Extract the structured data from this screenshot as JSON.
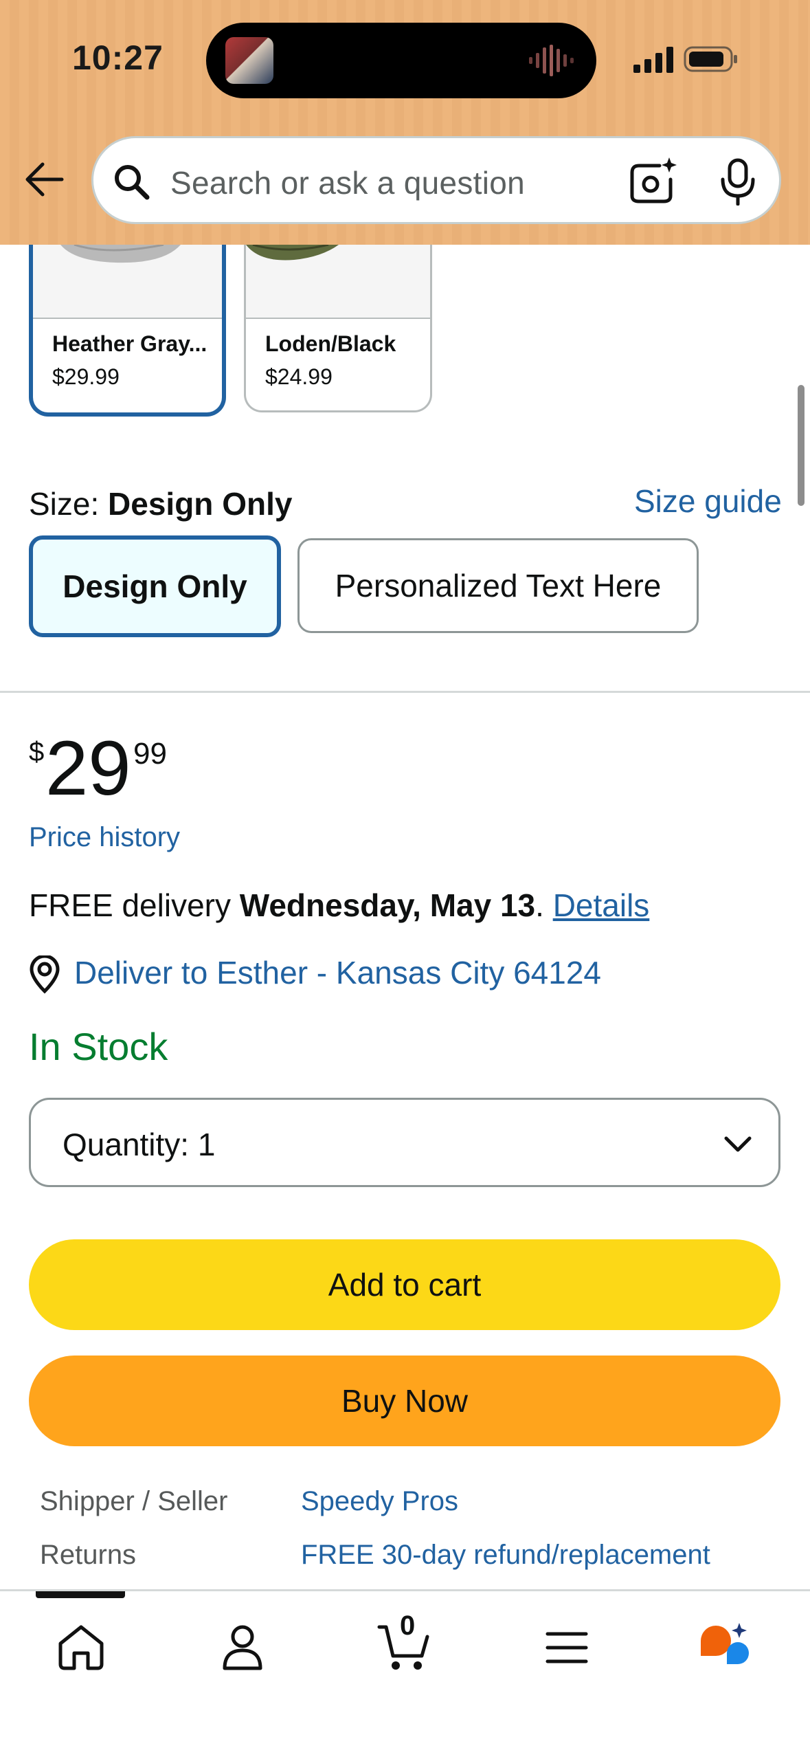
{
  "status_bar": {
    "time": "10:27"
  },
  "search": {
    "placeholder": "Search or ask a question"
  },
  "swatches": [
    {
      "name": "Heather Gray...",
      "price": "$29.99",
      "selected": true
    },
    {
      "name": "Loden/Black",
      "price": "$24.99",
      "selected": false
    }
  ],
  "size": {
    "label": "Size:",
    "selected_value": "Design Only",
    "guide_link": "Size guide",
    "options": [
      "Design Only",
      "Personalized Text Here"
    ]
  },
  "price": {
    "symbol": "$",
    "whole": "29",
    "fraction": "99",
    "history_link": "Price history"
  },
  "delivery": {
    "prefix": "FREE delivery ",
    "date": "Wednesday, May 13",
    "separator": ". ",
    "details_link": "Details",
    "deliver_to": "Deliver to Esther - Kansas City 64124"
  },
  "stock_status": "In Stock",
  "quantity": {
    "label": "Quantity:",
    "value": "1"
  },
  "buttons": {
    "add_to_cart": "Add to cart",
    "buy_now": "Buy Now"
  },
  "info": [
    {
      "label": "Shipper / Seller",
      "value": "Speedy Pros"
    },
    {
      "label": "Returns",
      "value": "FREE 30-day refund/replacement"
    }
  ],
  "bottom_nav": {
    "items": [
      "home-icon",
      "account-icon",
      "cart-icon",
      "menu-icon",
      "rufus-icon"
    ],
    "cart_count": "0"
  },
  "colors": {
    "header_bg": "#edb57c",
    "link": "#2162a1",
    "in_stock": "#067d30",
    "add_to_cart": "#fcd817",
    "buy_now": "#ffa41c"
  }
}
